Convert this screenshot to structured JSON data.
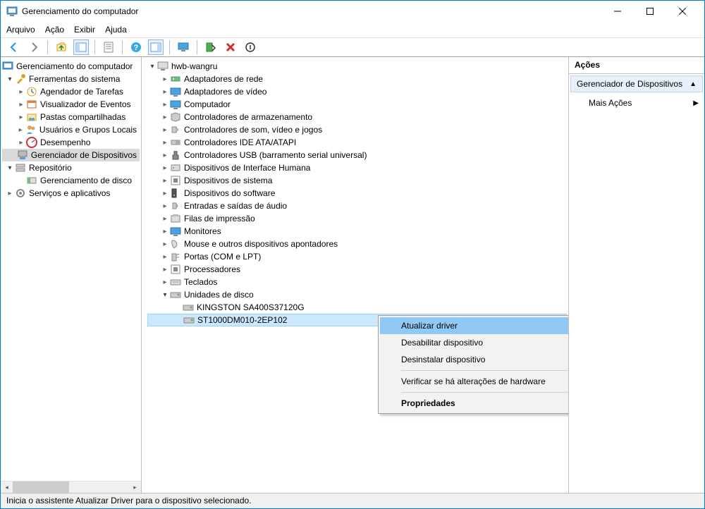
{
  "window": {
    "title": "Gerenciamento do computador"
  },
  "menu": {
    "file": "Arquivo",
    "action": "Ação",
    "view": "Exibir",
    "help": "Ajuda"
  },
  "left_tree": {
    "root": "Gerenciamento do computador",
    "sys_tools": "Ferramentas do sistema",
    "task_sched": "Agendador de Tarefas",
    "event_viewer": "Visualizador de Eventos",
    "shared": "Pastas compartilhadas",
    "users": "Usuários e Grupos Locais",
    "perf": "Desempenho",
    "devmgr": "Gerenciador de Dispositivos",
    "storage": "Repositório",
    "diskmgmt": "Gerenciamento de disco",
    "services": "Serviços e aplicativos"
  },
  "mid_tree": {
    "root": "hwb-wangru",
    "items": [
      "Adaptadores de rede",
      "Adaptadores de vídeo",
      "Computador",
      "Controladores de armazenamento",
      "Controladores de som, vídeo e jogos",
      "Controladores IDE ATA/ATAPI",
      "Controladores USB (barramento serial universal)",
      "Dispositivos de Interface Humana",
      "Dispositivos de sistema",
      "Dispositivos do software",
      "Entradas e saídas de áudio",
      "Filas de impressão",
      "Monitores",
      "Mouse e outros dispositivos apontadores",
      "Portas (COM e LPT)",
      "Processadores",
      "Teclados",
      "Unidades de disco"
    ],
    "disk1": "KINGSTON SA400S37120G",
    "disk2": "ST1000DM010-2EP102"
  },
  "ctx": {
    "update": "Atualizar driver",
    "disable": "Desabilitar dispositivo",
    "uninstall": "Desinstalar dispositivo",
    "scan": "Verificar se há alterações de hardware",
    "props": "Propriedades"
  },
  "actions": {
    "header": "Ações",
    "devmgr": "Gerenciador de Dispositivos",
    "more": "Mais Ações"
  },
  "status": "Inicia o assistente Atualizar Driver para o dispositivo selecionado."
}
